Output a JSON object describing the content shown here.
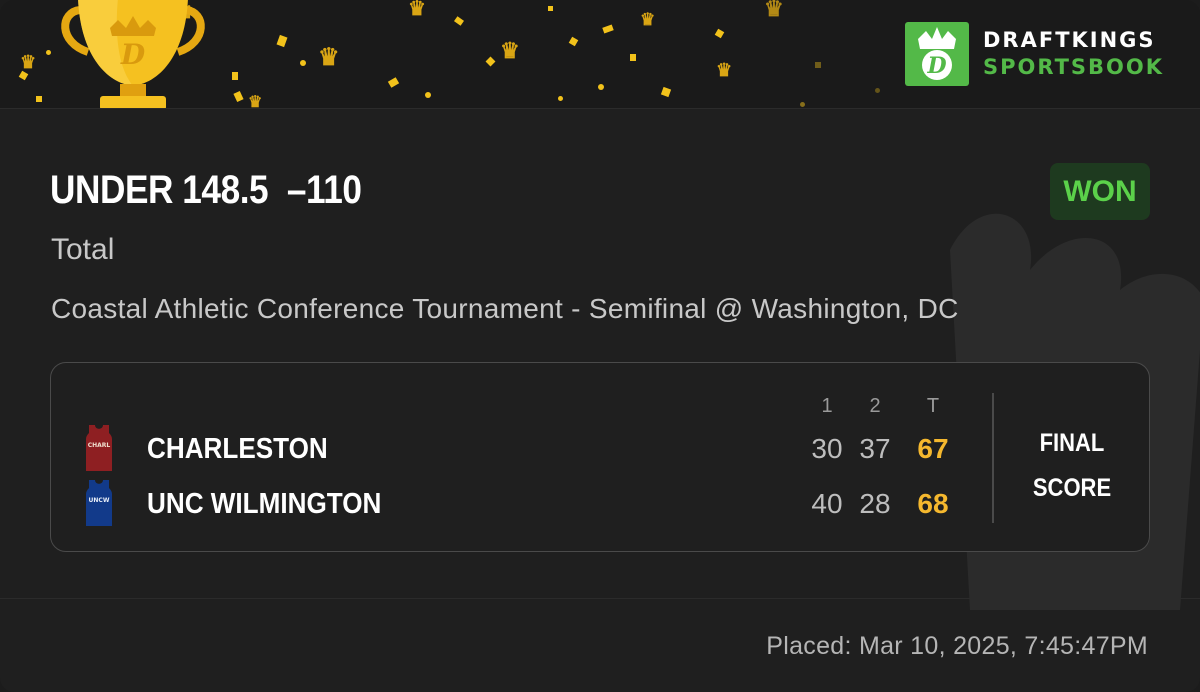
{
  "banner": {
    "logo_top": "DRAFTKINGS",
    "logo_bottom": "SPORTSBOOK",
    "brand_color": "#53b948",
    "confetti_color": "#f2c21b"
  },
  "bet": {
    "selection": "UNDER 148.5  –110",
    "status": "WON",
    "type": "Total",
    "event": "Coastal Athletic Conference Tournament - Semifinal @ Washington, DC"
  },
  "scoreboard": {
    "period_headers": [
      "1",
      "2",
      "T"
    ],
    "teams": [
      {
        "name": "CHARLESTON",
        "jersey_label": "CHARL",
        "jersey_color": "#8e1f22",
        "scores": [
          "30",
          "37",
          "67"
        ]
      },
      {
        "name": "UNC WILMINGTON",
        "jersey_label": "UNCW",
        "jersey_color": "#123a8a",
        "scores": [
          "40",
          "28",
          "68"
        ]
      }
    ],
    "final_line1": "FINAL",
    "final_line2": "SCORE"
  },
  "footer": {
    "placed": "Placed: Mar 10, 2025, 7:45:47PM"
  }
}
